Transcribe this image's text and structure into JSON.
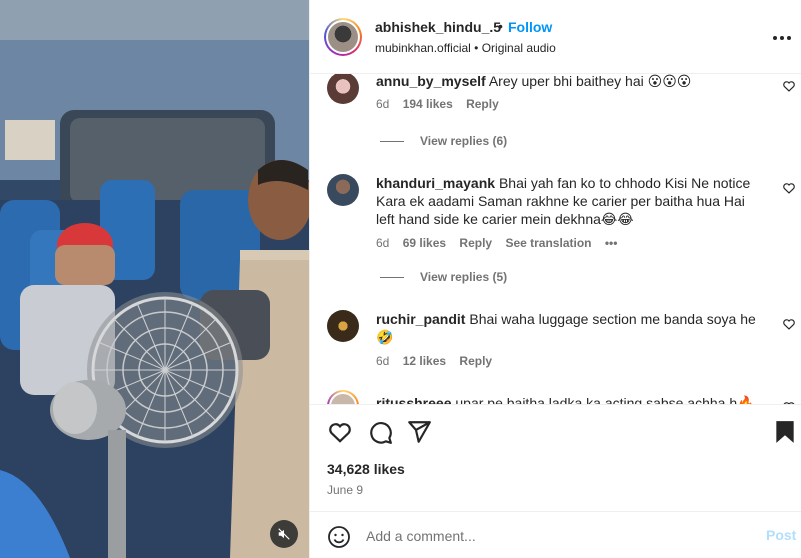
{
  "header": {
    "username": "abhishek_hindu_.5",
    "follow_label": "Follow",
    "subline": "mubinkhan.official • Original audio",
    "more_icon": "more-horizontal-icon"
  },
  "comments": [
    {
      "username": "annu_by_myself",
      "text": "Arey uper bhi baithey hai 😮😮😮",
      "time": "6d",
      "likes": "194 likes",
      "reply": "Reply",
      "view_replies": "View replies (6)"
    },
    {
      "username": "khanduri_mayank",
      "text": "Bhai yah fan ko to chhodo Kisi Ne notice Kara ek aadami Saman rakhne ke carier per baitha hua Hai left hand side ke carier mein dekhna😂😂",
      "time": "6d",
      "likes": "69 likes",
      "reply": "Reply",
      "see_translation": "See translation",
      "options": "•••",
      "view_replies": "View replies (5)"
    },
    {
      "username": "ruchir_pandit",
      "text": "Bhai waha luggage section me banda soya he 🤣",
      "time": "6d",
      "likes": "12 likes",
      "reply": "Reply"
    },
    {
      "username": "ritusshreee",
      "text": "upar pe baitha ladka ka acting sabse achha h🔥"
    }
  ],
  "actions": {
    "likes": "34,628 likes",
    "date": "June 9"
  },
  "add_comment": {
    "placeholder": "Add a comment...",
    "post_label": "Post"
  }
}
